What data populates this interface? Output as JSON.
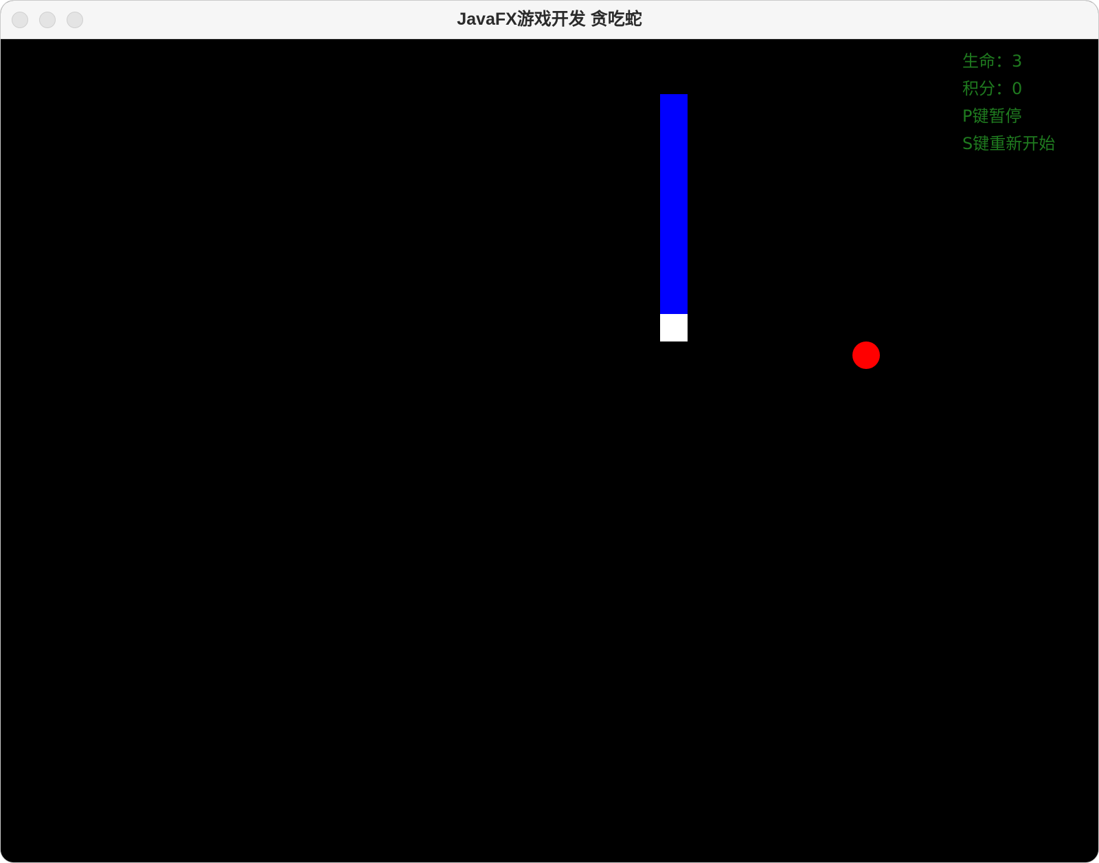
{
  "window": {
    "title": "JavaFX游戏开发 贪吃蛇",
    "controls": [
      "close",
      "minimize",
      "zoom"
    ]
  },
  "game": {
    "background_color": "#000000",
    "grid_cell": 40,
    "snake": {
      "body_color": "#0000ff",
      "head_color": "#ffffff",
      "segments": [
        {
          "col": 24,
          "row": 2
        },
        {
          "col": 24,
          "row": 3
        },
        {
          "col": 24,
          "row": 4
        },
        {
          "col": 24,
          "row": 5
        },
        {
          "col": 24,
          "row": 6
        },
        {
          "col": 24,
          "row": 7
        },
        {
          "col": 24,
          "row": 8
        },
        {
          "col": 24,
          "row": 9
        }
      ],
      "head": {
        "col": 24,
        "row": 10
      }
    },
    "food": {
      "color": "#ff0000",
      "col": 31,
      "row": 11
    }
  },
  "hud": {
    "lives": "生命：3",
    "score": "积分：0",
    "pause_hint": "P键暂停",
    "restart_hint": "S键重新开始",
    "text_color": "#1f7a1f"
  }
}
